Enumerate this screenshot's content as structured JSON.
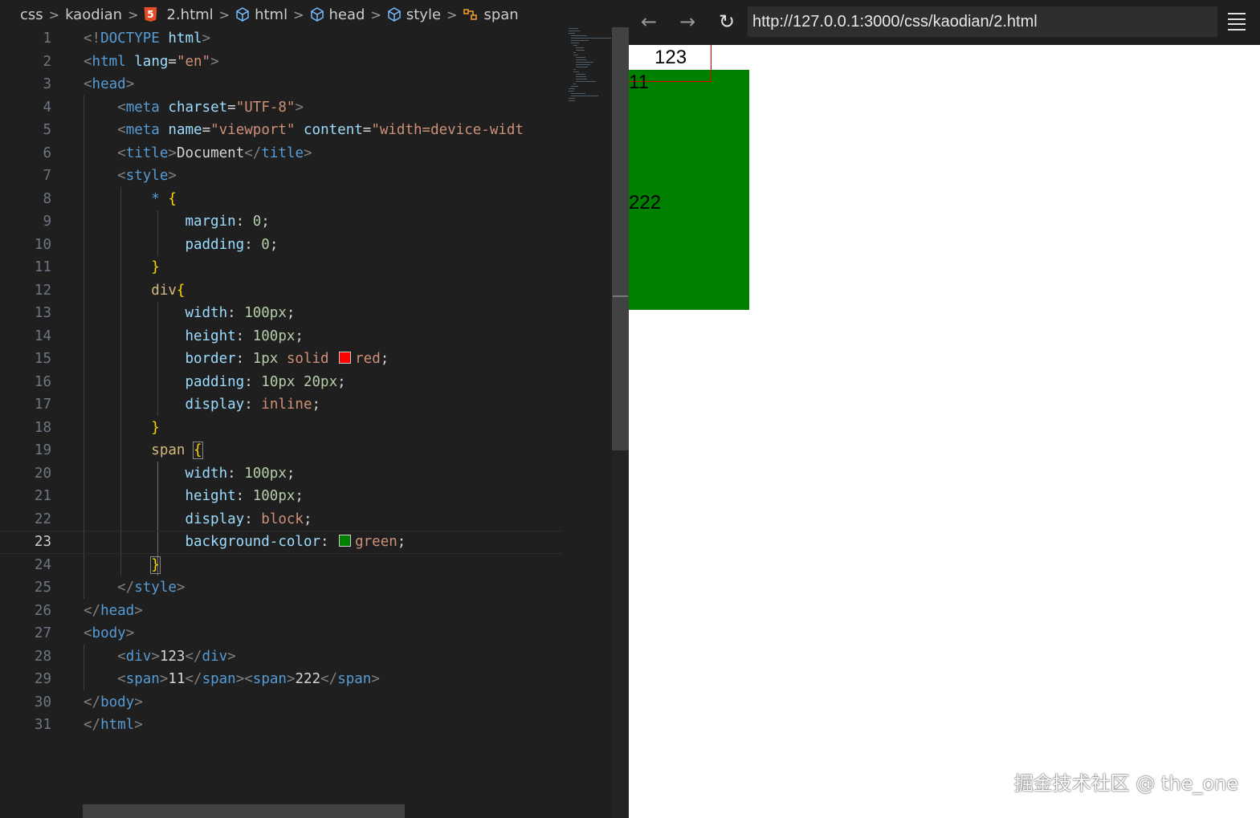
{
  "breadcrumb": {
    "items": [
      "css",
      "kaodian",
      "2.html",
      "html",
      "head",
      "style",
      "span"
    ]
  },
  "editor": {
    "line_numbers": [
      "1",
      "2",
      "3",
      "4",
      "5",
      "6",
      "7",
      "8",
      "9",
      "10",
      "11",
      "12",
      "13",
      "14",
      "15",
      "16",
      "17",
      "18",
      "19",
      "20",
      "21",
      "22",
      "23",
      "24",
      "25",
      "26",
      "27",
      "28",
      "29",
      "30",
      "31"
    ],
    "active_line": 23,
    "colors": {
      "red_swatch": "#ff0000",
      "green_swatch": "#008000"
    }
  },
  "browser": {
    "back_icon": "arrow-left-icon",
    "forward_icon": "arrow-right-icon",
    "reload_icon": "reload-icon",
    "url": "http://127.0.0.1:3000/css/kaodian/2.html",
    "menu_icon": "hamburger-menu-icon",
    "page": {
      "div_text": "123",
      "span1_text": "11",
      "span2_text": "222"
    },
    "watermark": "掘金技术社区 @ the_one"
  }
}
